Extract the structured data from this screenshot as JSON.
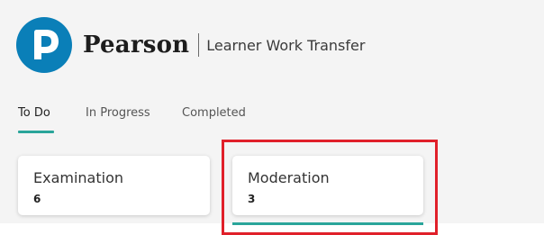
{
  "brand": {
    "logo_icon": "pearson-p-logo",
    "name": "Pearson",
    "app_title": "Learner Work Transfer",
    "logo_color": "#0a7fb8"
  },
  "tabs": [
    {
      "label": "To Do",
      "active": true
    },
    {
      "label": "In Progress",
      "active": false
    },
    {
      "label": "Completed",
      "active": false
    }
  ],
  "cards": [
    {
      "title": "Examination",
      "count": "6",
      "selected": false
    },
    {
      "title": "Moderation",
      "count": "3",
      "selected": true
    }
  ],
  "colors": {
    "accent": "#2aa59a",
    "highlight": "#e0202a",
    "background": "#f4f4f4"
  }
}
